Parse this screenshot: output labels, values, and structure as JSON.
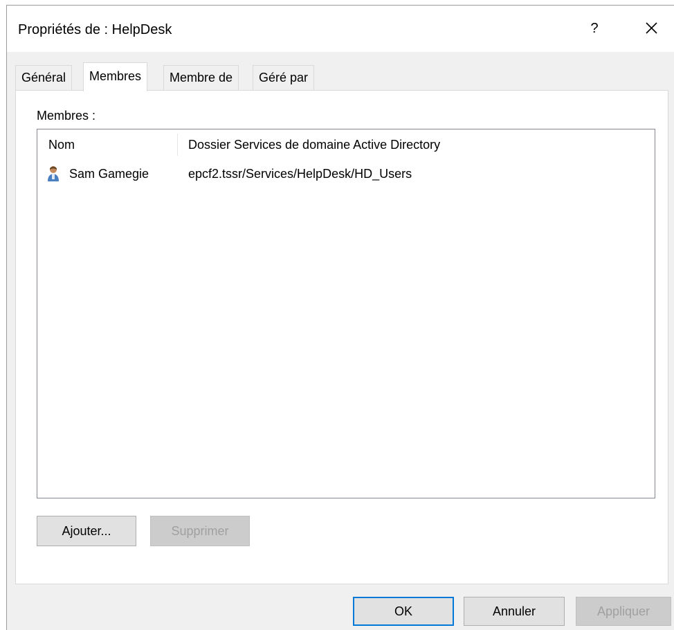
{
  "window": {
    "title": "Propriétés de : HelpDesk",
    "help_label": "?",
    "close_icon": "close-icon"
  },
  "tabs": [
    {
      "label": "Général",
      "active": false
    },
    {
      "label": "Membres",
      "active": true
    },
    {
      "label": "Membre de",
      "active": false
    },
    {
      "label": "Géré par",
      "active": false
    }
  ],
  "members": {
    "label": "Membres :",
    "columns": [
      "Nom",
      "Dossier Services de domaine Active Directory"
    ],
    "rows": [
      {
        "icon": "user-icon",
        "name": "Sam Gamegie",
        "folder": "epcf2.tssr/Services/HelpDesk/HD_Users"
      }
    ],
    "add_button": "Ajouter...",
    "remove_button": "Supprimer"
  },
  "footer": {
    "ok": "OK",
    "cancel": "Annuler",
    "apply": "Appliquer"
  },
  "colors": {
    "dialog_bg": "#f0f0f0",
    "default_button_border": "#0078d7"
  }
}
